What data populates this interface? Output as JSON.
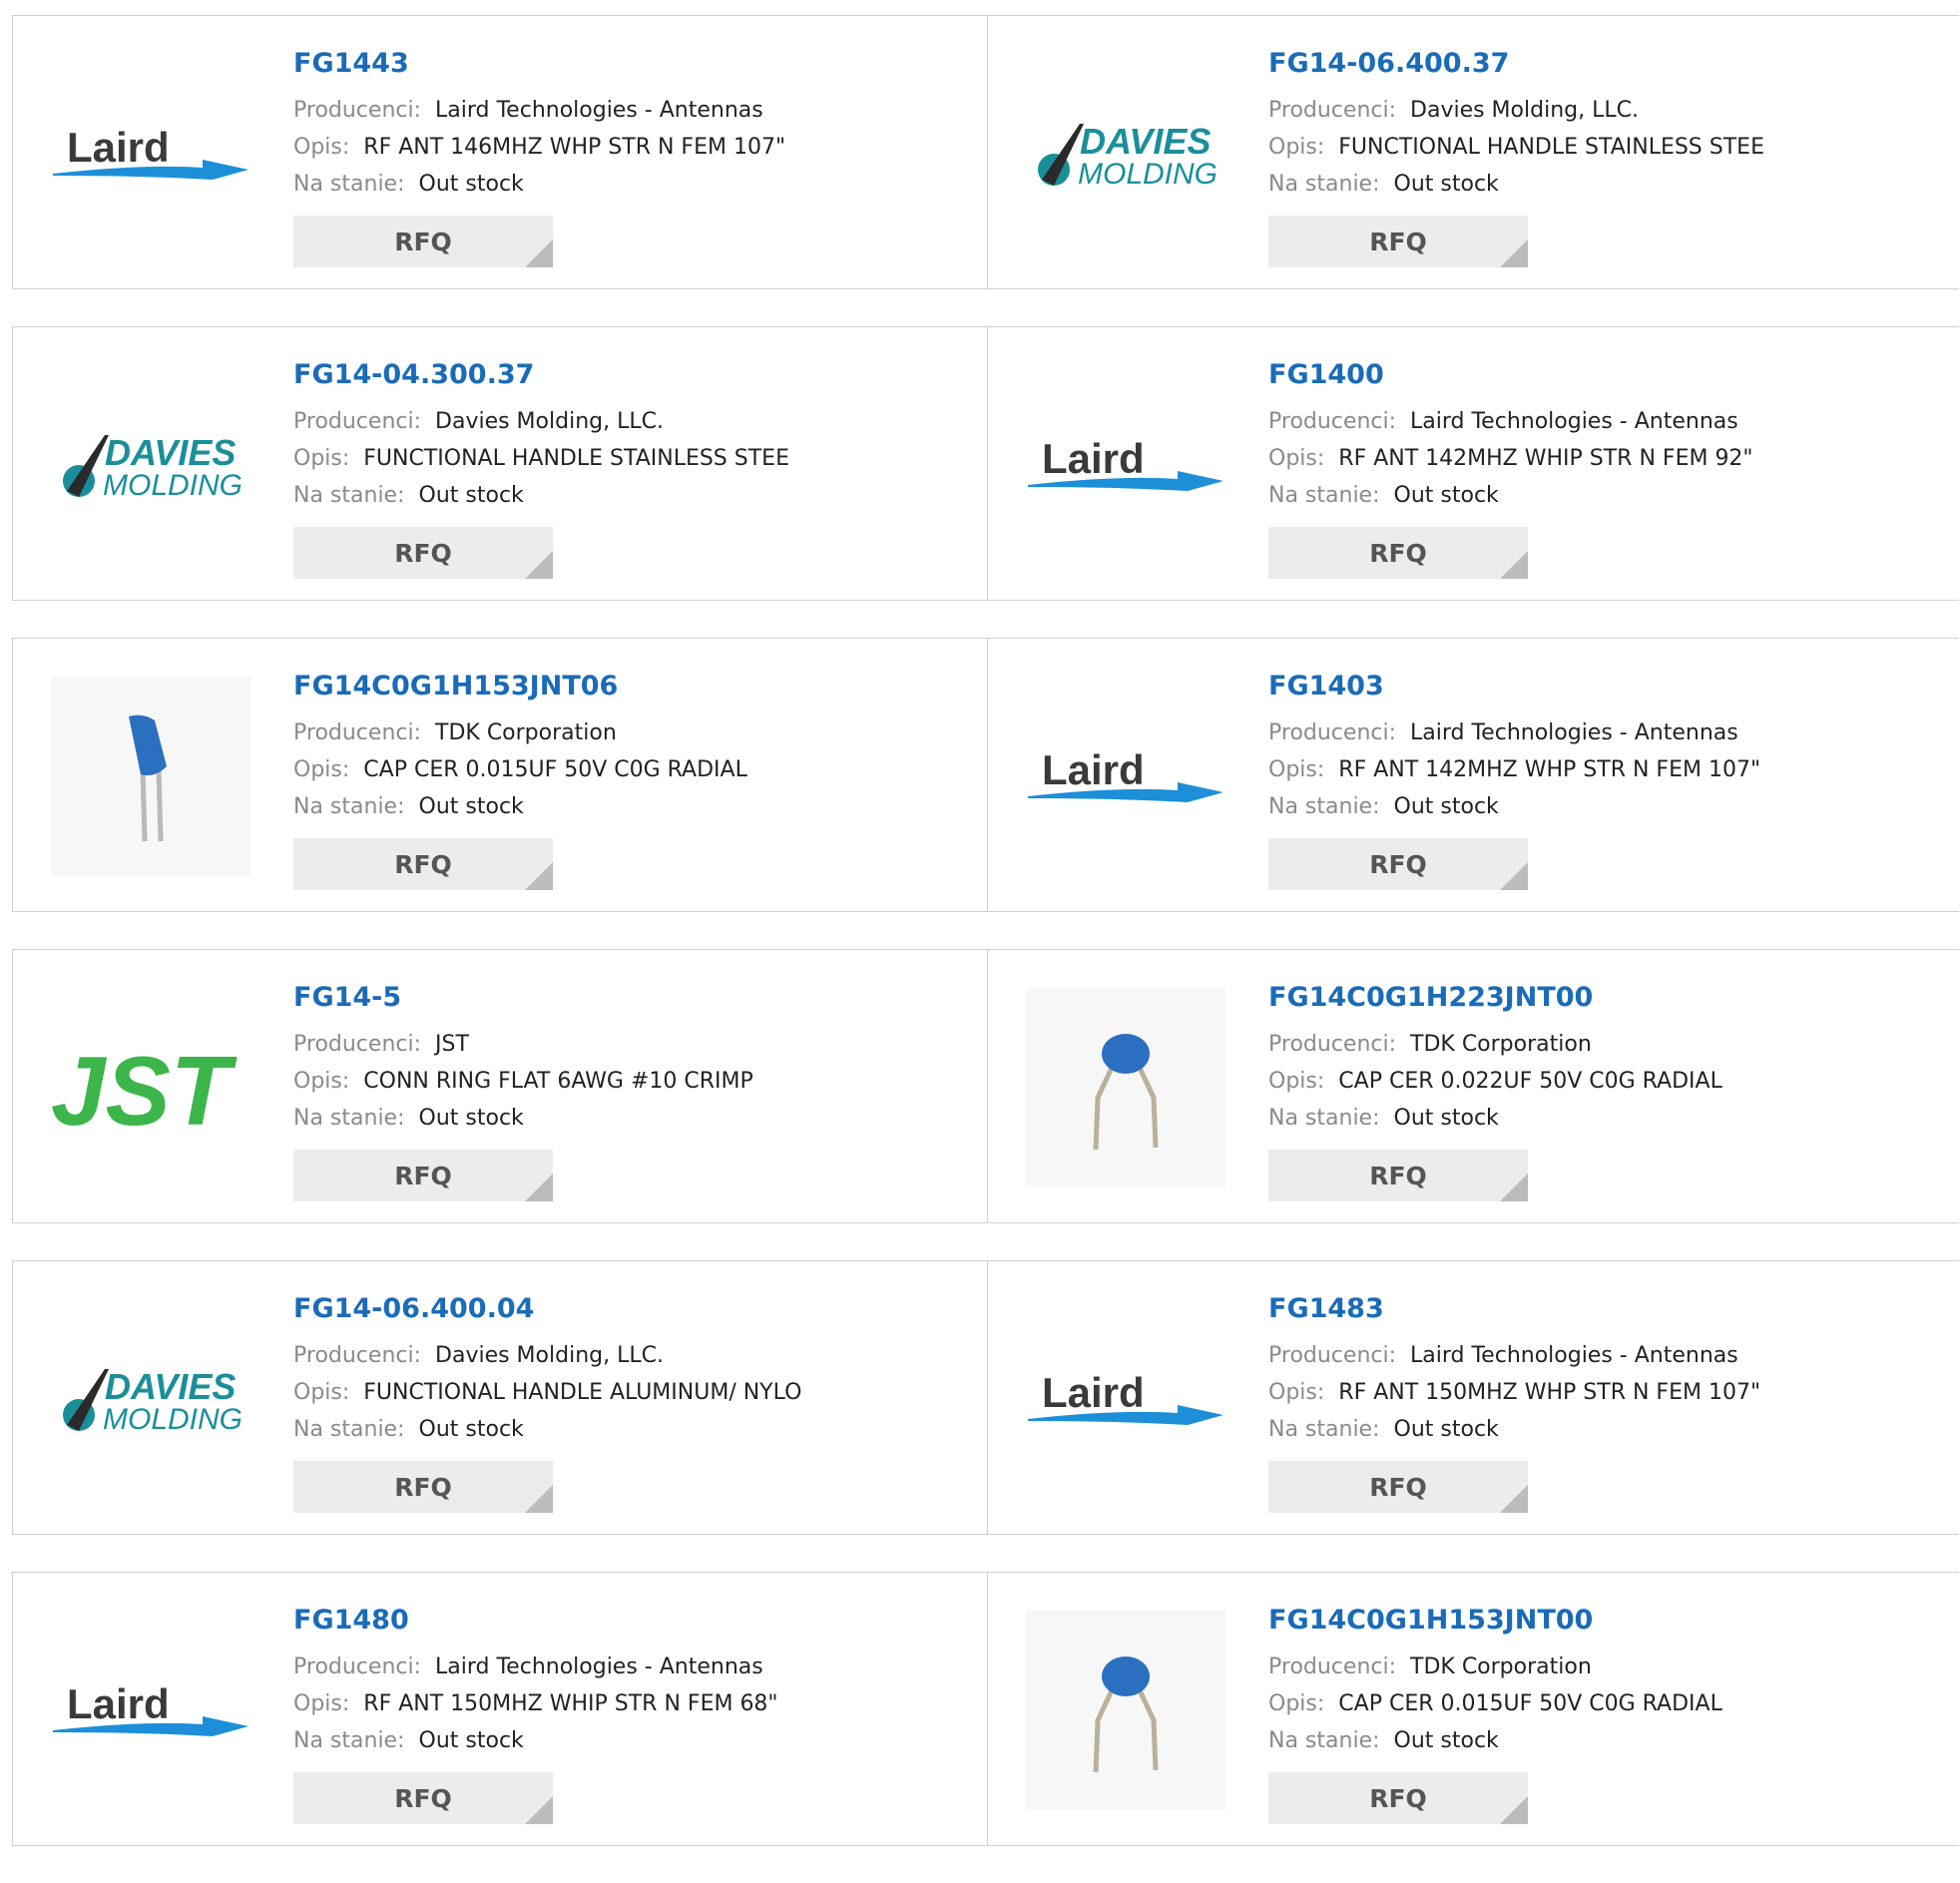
{
  "labels": {
    "manufacturer": "Producenci:",
    "description": "Opis:",
    "stock": "Na stanie:",
    "rfq": "RFQ"
  },
  "colors": {
    "part_link": "#1a6bb8",
    "label": "#8a8a8a",
    "rfq_bg": "#ececec",
    "laird_blue": "#1c8fd8",
    "davies_teal": "#1a8f9a",
    "jst_green": "#3cb54a",
    "capacitor_blue": "#2a6fc0"
  },
  "logo_text": {
    "laird": "Laird",
    "davies_1": "DAVIES",
    "davies_2": "MOLDING",
    "jst": "JST"
  },
  "products": [
    {
      "part": "FG1443",
      "manufacturer": "Laird Technologies - Antennas",
      "description": "RF ANT 146MHZ WHP STR N FEM 107\"",
      "stock": "Out stock",
      "logo": "laird"
    },
    {
      "part": "FG14-06.400.37",
      "manufacturer": "Davies Molding, LLC.",
      "description": "FUNCTIONAL HANDLE STAINLESS STEE",
      "stock": "Out stock",
      "logo": "davies"
    },
    {
      "part": "FG14-04.300.37",
      "manufacturer": "Davies Molding, LLC.",
      "description": "FUNCTIONAL HANDLE STAINLESS STEE",
      "stock": "Out stock",
      "logo": "davies"
    },
    {
      "part": "FG1400",
      "manufacturer": "Laird Technologies - Antennas",
      "description": "RF ANT 142MHZ WHIP STR N FEM 92\"",
      "stock": "Out stock",
      "logo": "laird"
    },
    {
      "part": "FG14C0G1H153JNT06",
      "manufacturer": "TDK Corporation",
      "description": "CAP CER 0.015UF 50V C0G RADIAL",
      "stock": "Out stock",
      "logo": "capacitor-tall"
    },
    {
      "part": "FG1403",
      "manufacturer": "Laird Technologies - Antennas",
      "description": "RF ANT 142MHZ WHP STR N FEM 107\"",
      "stock": "Out stock",
      "logo": "laird"
    },
    {
      "part": "FG14-5",
      "manufacturer": "JST",
      "description": "CONN RING FLAT 6AWG #10 CRIMP",
      "stock": "Out stock",
      "logo": "jst"
    },
    {
      "part": "FG14C0G1H223JNT00",
      "manufacturer": "TDK Corporation",
      "description": "CAP CER 0.022UF 50V C0G RADIAL",
      "stock": "Out stock",
      "logo": "capacitor-bent"
    },
    {
      "part": "FG14-06.400.04",
      "manufacturer": "Davies Molding, LLC.",
      "description": "FUNCTIONAL HANDLE ALUMINUM/ NYLO",
      "stock": "Out stock",
      "logo": "davies"
    },
    {
      "part": "FG1483",
      "manufacturer": "Laird Technologies - Antennas",
      "description": "RF ANT 150MHZ WHP STR N FEM 107\"",
      "stock": "Out stock",
      "logo": "laird"
    },
    {
      "part": "FG1480",
      "manufacturer": "Laird Technologies - Antennas",
      "description": "RF ANT 150MHZ WHIP STR N FEM 68\"",
      "stock": "Out stock",
      "logo": "laird"
    },
    {
      "part": "FG14C0G1H153JNT00",
      "manufacturer": "TDK Corporation",
      "description": "CAP CER 0.015UF 50V C0G RADIAL",
      "stock": "Out stock",
      "logo": "capacitor-bent"
    }
  ]
}
